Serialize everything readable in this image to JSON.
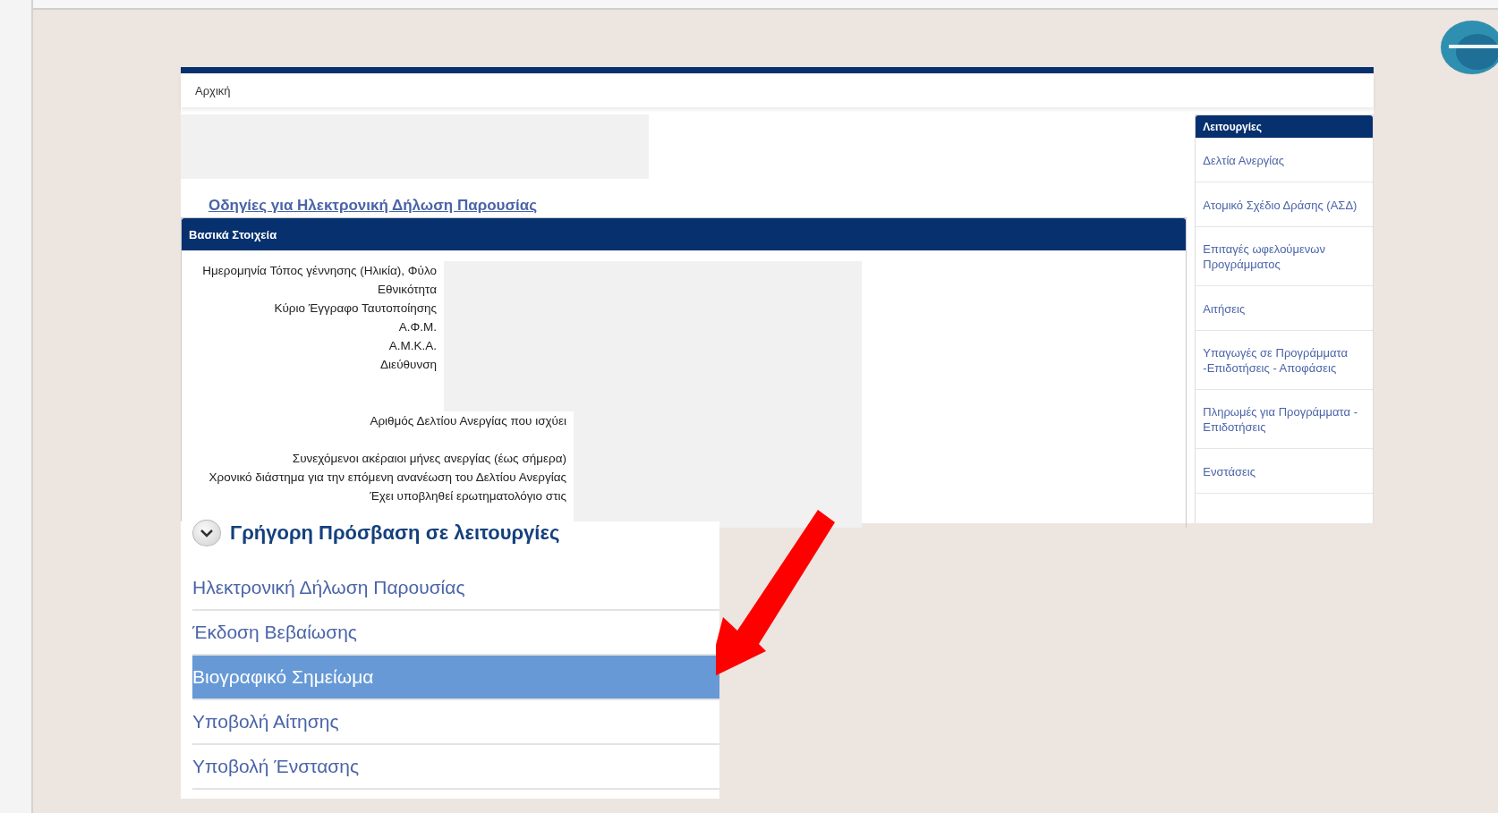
{
  "breadcrumb": "Αρχική",
  "instructions_link": "Οδηγίες για Ηλεκτρονική Δήλωση Παρουσίας",
  "basic_info": {
    "title": "Βασικά Στοιχεία",
    "field_groups": [
      [
        "Ημερομηνία Τόπος γέννησης (Ηλικία), Φύλο",
        "Εθνικότητα",
        "Κύριο Έγγραφο Ταυτοποίησης",
        "Α.Φ.Μ.",
        "Α.Μ.Κ.Α.",
        "Διεύθυνση"
      ],
      [
        "Αριθμός Δελτίου Ανεργίας που ισχύει"
      ],
      [
        "Συνεχόμενοι ακέραιοι μήνες ανεργίας (έως σήμερα)",
        "Χρονικό διάστημα για την επόμενη ανανέωση του Δελτίου Ανεργίας",
        "Έχει υποβληθεί ερωτηματολόγιο στις"
      ]
    ]
  },
  "sidebar": {
    "title": "Λειτουργίες",
    "items": [
      "Δελτία Ανεργίας",
      "Ατομικό Σχέδιο Δράσης (ΑΣΔ)",
      "Επιταγές ωφελούμενων Προγράμματος",
      "Αιτήσεις",
      "Υπαγωγές σε Προγράμματα -Επιδοτήσεις - Αποφάσεις",
      "Πληρωμές για Προγράμματα - Επιδοτήσεις",
      "Ενστάσεις"
    ]
  },
  "quick_access": {
    "title": "Γρήγορη Πρόσβαση σε λειτουργίες",
    "expanded": true,
    "items": [
      {
        "label": "Ηλεκτρονική Δήλωση Παρουσίας",
        "selected": false
      },
      {
        "label": "Έκδοση Βεβαίωσης",
        "selected": false
      },
      {
        "label": "Βιογραφικό Σημείωμα",
        "selected": true
      },
      {
        "label": "Υποβολή Αίτησης",
        "selected": false
      },
      {
        "label": "Υποβολή Ένστασης",
        "selected": false
      }
    ]
  }
}
